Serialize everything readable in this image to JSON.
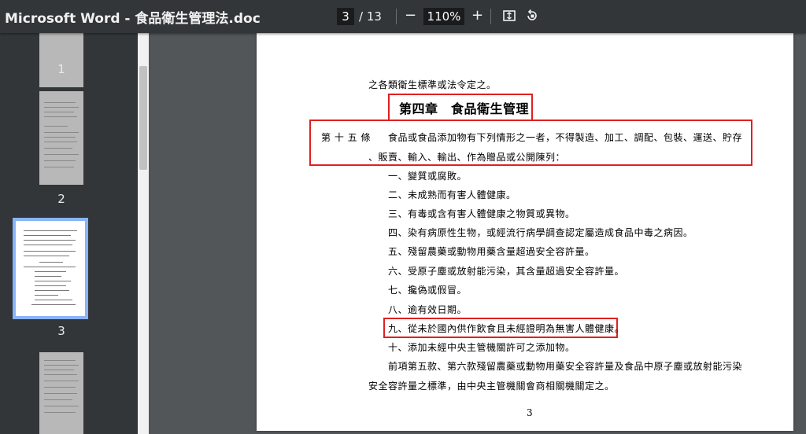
{
  "toolbar": {
    "title": "Microsoft Word - 食品衛生管理法.doc",
    "current_page": "3",
    "total_pages": "/ 13",
    "zoom_out": "−",
    "zoom_level": "110%",
    "zoom_in": "+"
  },
  "thumbnails": [
    {
      "label": "1"
    },
    {
      "label": "2"
    },
    {
      "label": "3"
    },
    {
      "label": ""
    }
  ],
  "document": {
    "top_fragment": "之各類衛生標準或法令定之。",
    "chapter_title": "第四章　食品衛生管理",
    "article_label": "第 十 五 條",
    "article_text_1": "食品或食品添加物有下列情形之一者，不得製造、加工、調配、包裝、運送、貯存",
    "article_text_2": "、販賣、輸入、輸出、作為贈品或公開陳列：",
    "items": [
      "一、變質或腐敗。",
      "二、未成熟而有害人體健康。",
      "三、有毒或含有害人體健康之物質或異物。",
      "四、染有病原性生物，或經流行病學調查認定屬造成食品中毒之病因。",
      "五、殘留農藥或動物用藥含量超過安全容許量。",
      "六、受原子塵或放射能污染，其含量超過安全容許量。",
      "七、攙偽或假冒。",
      "八、逾有效日期。",
      "九、從未於國內供作飲食且未經證明為無害人體健康。",
      "十、添加未經中央主管機關許可之添加物。"
    ],
    "para_1": "前項第五款、第六款殘留農藥或動物用藥安全容許量及食品中原子塵或放射能污染",
    "para_2": "安全容許量之標準，由中央主管機關會商相關機關定之。",
    "page_number": "3"
  },
  "colors": {
    "highlight": "#e02020",
    "selected_thumb": "#8ab4f8"
  }
}
